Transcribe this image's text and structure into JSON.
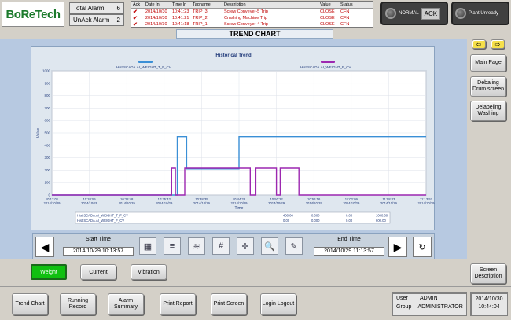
{
  "logo": {
    "text": "BoReTech"
  },
  "alarms": {
    "total_label": "Total Alarm",
    "total_count": "6",
    "unack_label": "UnAck Alarm",
    "unack_count": "2"
  },
  "alarm_table": {
    "headers": [
      "Ack",
      "Date In",
      "Time In",
      "Tagname",
      "Description",
      "Value",
      "Status"
    ],
    "rows": [
      {
        "ack": "✔",
        "date": "2014/10/30",
        "time": "10:41:23",
        "tag": "TRIP_3",
        "desc": "Screw Conveyer-5 Trip",
        "value": "CLOSE",
        "status": "CFN"
      },
      {
        "ack": "✔",
        "date": "2014/10/30",
        "time": "10:41:21",
        "tag": "TRIP_2",
        "desc": "Crushing Machine Trip",
        "value": "CLOSE",
        "status": "CFN"
      },
      {
        "ack": "✔",
        "date": "2014/10/30",
        "time": "10:41:18",
        "tag": "TRIP_1",
        "desc": "Screw Conveyer-4 Trip",
        "value": "CLOSE",
        "status": "CFN"
      }
    ]
  },
  "status": {
    "normal": "NORMAL",
    "ack": "ACK",
    "plant": "Plant Unready"
  },
  "page_title": "TREND CHART",
  "chart": {
    "title": "Historical Trend",
    "legend1": "Hist:SCADA.AI_WEIGHT_T_F_CV",
    "legend2": "Hist:SCADA.AI_WEIGHT_F_CV",
    "ylabel": "Value",
    "xlabel": "Time",
    "table_row1": [
      "Hist:SCADA.AI_WEIGHT_T_F_CV",
      "400.00",
      "0.000",
      "0.00",
      "1000.00"
    ],
    "table_row2": [
      "Hist:SCADA.AI_WEIGHT_F_CV",
      "0.00",
      "0.000",
      "0.00",
      "600.00"
    ]
  },
  "chart_data": {
    "type": "line",
    "title": "Historical Trend",
    "xlabel": "Time",
    "ylabel": "Value",
    "ylim": [
      0,
      1000
    ],
    "yticks": [
      0,
      100,
      200,
      300,
      400,
      500,
      600,
      700,
      800,
      900,
      1000
    ],
    "xticks": [
      "10:13:01\n2014/10/29",
      "10:20:55\n2014/10/29",
      "10:28:48\n2014/10/29",
      "10:35:42\n2014/10/29",
      "10:38:35\n2014/10/29",
      "10:44:28\n2014/10/29",
      "10:50:22\n2014/10/29",
      "10:56:16\n2014/10/29",
      "11:02:09\n2014/10/29",
      "11:08:03\n2014/10/29",
      "11:13:57\n2014/10/29"
    ],
    "series": [
      {
        "name": "Hist:SCADA.AI_WEIGHT_T_F_CV",
        "color": "#3a8fd6",
        "x": [
          0,
          3.35,
          3.35,
          3.6,
          3.6,
          5.0,
          5.0,
          10.0
        ],
        "values": [
          0,
          0,
          470,
          470,
          210,
          210,
          470,
          470
        ]
      },
      {
        "name": "Hist:SCADA.AI_WEIGHT_F_CV",
        "color": "#9c27b0",
        "x": [
          0,
          3.2,
          3.2,
          3.3,
          3.3,
          3.55,
          3.55,
          5.3,
          5.3,
          5.45,
          5.45,
          5.5,
          5.5,
          6.0,
          6.0,
          6.1,
          6.1,
          6.6,
          6.6,
          6.7,
          6.7,
          10.0
        ],
        "values": [
          0,
          0,
          215,
          215,
          0,
          0,
          215,
          215,
          0,
          0,
          215,
          215,
          215,
          215,
          0,
          0,
          215,
          215,
          0,
          0,
          0,
          0
        ]
      }
    ]
  },
  "trend_controls": {
    "start_label": "Start Time",
    "start_value": "2014/10/29 10:13:57",
    "end_label": "End Time",
    "end_value": "2014/10/29 11:13:57"
  },
  "selectors": {
    "weight": "Weight",
    "current": "Current",
    "vibration": "Vibration"
  },
  "sidebar": {
    "main_page": "Main Page",
    "debaling_drum": "Debaling Drum screen",
    "delabeling_washing": "Delabeling Washing",
    "screen_desc": "Screen Description"
  },
  "footer": {
    "trend_chart": "Trend Chart",
    "running_record": "Running Record",
    "alarm_summary": "Alarm Summary",
    "print_report": "Print Report",
    "print_screen": "Print Screen",
    "login_logout": "Login Logout"
  },
  "user": {
    "user_label": "User",
    "user_value": "ADMIN",
    "group_label": "Group",
    "group_value": "ADMINISTRATOR"
  },
  "datetime": {
    "date": "2014/10/30",
    "time": "10:44:04"
  }
}
